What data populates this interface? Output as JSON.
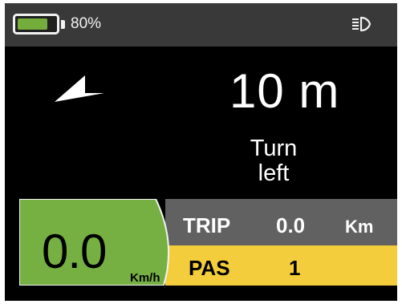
{
  "status_bar": {
    "battery_percent": 80,
    "battery_text": "80%",
    "headlight_icon": "headlight-icon"
  },
  "navigation": {
    "direction_icon": "turn-left-arrow-icon",
    "distance": "10 m",
    "instruction_line1": "Turn",
    "instruction_line2": "left"
  },
  "speed": {
    "value": "0.0",
    "unit": "Km/h"
  },
  "trip": {
    "label": "TRIP",
    "value": "0.0",
    "unit": "Km"
  },
  "pas": {
    "label": "PAS",
    "value": "1"
  },
  "colors": {
    "background": "#000000",
    "status_bar": "#393939",
    "battery_fill": "#74ad3c",
    "speed_panel": "#76b043",
    "trip_row": "#616161",
    "pas_row": "#f3cd3b"
  }
}
